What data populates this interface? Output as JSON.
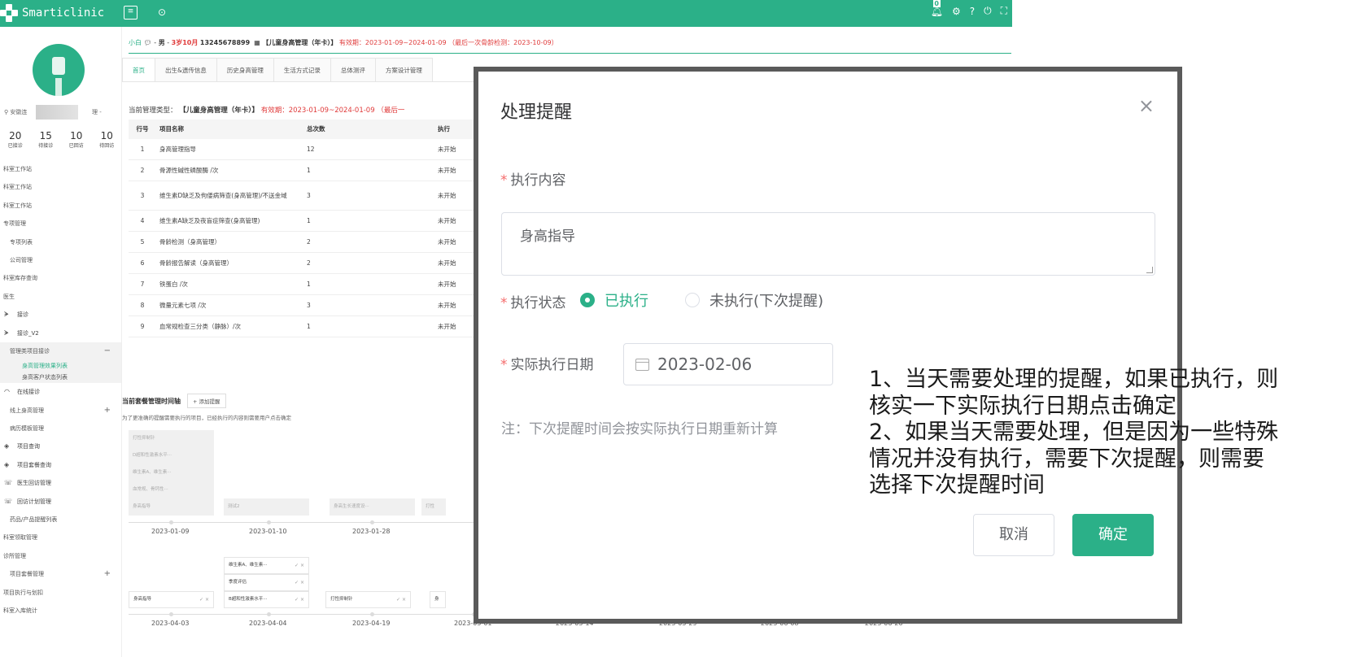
{
  "app": {
    "name": "Smarticlinic"
  },
  "topbar": {
    "notification_count": "0"
  },
  "sidebar": {
    "location": "安徽连",
    "role": "理 -",
    "stats": [
      {
        "num": "20",
        "label": "已接诊"
      },
      {
        "num": "15",
        "label": "待接诊"
      },
      {
        "num": "10",
        "label": "已回访"
      },
      {
        "num": "10",
        "label": "待回访"
      }
    ],
    "nav": [
      {
        "label": "科室工作站",
        "kind": "plain"
      },
      {
        "label": "科室工作站",
        "kind": "plain"
      },
      {
        "label": "科室工作站",
        "kind": "plain"
      },
      {
        "label": "专项管理",
        "kind": "plain"
      },
      {
        "label": "专项列表",
        "kind": "indent"
      },
      {
        "label": "公司管理",
        "kind": "indent"
      },
      {
        "label": "科室库存查询",
        "kind": "plain"
      },
      {
        "label": "医生",
        "kind": "plain"
      },
      {
        "label": "接诊",
        "kind": "icon",
        "icon": "ᗘ"
      },
      {
        "label": "接诊_V2",
        "kind": "icon",
        "icon": "ᗘ"
      },
      {
        "label": "管理类项目接诊",
        "kind": "group",
        "suffix": "−"
      },
      {
        "label": "身高管理效果列表",
        "kind": "active"
      },
      {
        "label": "身高客户状态列表",
        "kind": "sub"
      },
      {
        "label": "在线接诊",
        "kind": "icon",
        "icon": "◠"
      },
      {
        "label": "线上身高管理",
        "kind": "indent",
        "suffix": "+"
      },
      {
        "label": "病历模板管理",
        "kind": "indent"
      },
      {
        "label": "项目查询",
        "kind": "icon",
        "icon": "◈"
      },
      {
        "label": "项目套餐查询",
        "kind": "icon",
        "icon": "◈"
      },
      {
        "label": "医生回访管理",
        "kind": "icon",
        "icon": "☏"
      },
      {
        "label": "回访计划管理",
        "kind": "icon",
        "icon": "☏"
      },
      {
        "label": "药品/产品提醒列表",
        "kind": "indent"
      },
      {
        "label": "科室领取管理",
        "kind": "plain"
      },
      {
        "label": "诊所管理",
        "kind": "plain"
      },
      {
        "label": "项目套餐管理",
        "kind": "indent",
        "suffix": "+"
      },
      {
        "label": "项目执行与划扣",
        "kind": "plain"
      },
      {
        "label": "科室入库统计",
        "kind": "plain"
      }
    ]
  },
  "patient": {
    "name": "小白",
    "gender": "男",
    "age": "3岁10月",
    "phone": "13245678899",
    "package": "【儿童身高管理（年卡）】",
    "validity": "有效期：2023-01-09~2024-01-09",
    "last_check": "（最后一次骨龄检测：2023-10-09）"
  },
  "tabs": [
    "首页",
    "出生&遗传信息",
    "历史身高管理",
    "生活方式记录",
    "总体测评",
    "方案设计管理"
  ],
  "management": {
    "type_label": "当前管理类型：",
    "type_value": "【儿童身高管理（年卡）】",
    "validity": "有效期：2023-01-09~2024-01-09",
    "extra": "（最后一"
  },
  "table": {
    "headers": [
      "行号",
      "项目名称",
      "总次数",
      "执行"
    ],
    "rows": [
      {
        "no": "1",
        "name": "身高管理指导",
        "total": "12",
        "status": "未开始"
      },
      {
        "no": "2",
        "name": "骨源性碱性磷酸酶 /次",
        "total": "1",
        "status": "未开始"
      },
      {
        "no": "3",
        "name": "维生素D缺乏及佝偻病筛查(身高管理)/不送金域",
        "total": "3",
        "status": "未开始"
      },
      {
        "no": "4",
        "name": "维生素A缺乏及夜盲症筛查(身高管理)",
        "total": "1",
        "status": "未开始"
      },
      {
        "no": "5",
        "name": "骨龄检测（身高管理）",
        "total": "2",
        "status": "未开始"
      },
      {
        "no": "6",
        "name": "骨龄报告解读（身高管理）",
        "total": "2",
        "status": "未开始"
      },
      {
        "no": "7",
        "name": "铁蛋白 /次",
        "total": "1",
        "status": "未开始"
      },
      {
        "no": "8",
        "name": "微量元素七项 /次",
        "total": "3",
        "status": "未开始"
      },
      {
        "no": "9",
        "name": "血常规检查三分类（静脉）/次",
        "total": "1",
        "status": "未开始"
      }
    ]
  },
  "timeline": {
    "title": "当前套餐管理时间轴",
    "add_label": "+ 添加提醒",
    "note": "为了更准确的提醒需要执行的项目，已经执行的内容则需要用户点击确定",
    "row1_cards": [
      "打性抑制针",
      "D超和性激素水平···",
      "维生素A、维生素···",
      "血常规、骨钙性···",
      "身高指导"
    ],
    "row1_others": [
      "测试2",
      "身高生长速度设···",
      "打性"
    ],
    "row1_dates": [
      "2023-01-09",
      "2023-01-10",
      "2023-01-28"
    ],
    "row2_cards": [
      {
        "label": "维生素A、维生素···",
        "chk": "✓ ×"
      },
      {
        "label": "季度评估",
        "chk": "✓ ×"
      },
      {
        "label": "B超和性激素水平···",
        "chk": "✓ ×"
      },
      {
        "label": "身高指导",
        "chk": "✓ ×"
      },
      {
        "label": "打性抑制针",
        "chk": "✓ ×"
      },
      {
        "label": "身",
        "chk": ""
      }
    ],
    "row2_dates": [
      "2023-04-03",
      "2023-04-04",
      "2023-04-19",
      "2023-05-01",
      "2023-05-14",
      "2023-05-29",
      "2023-06-08",
      "2023-06-26"
    ]
  },
  "dialog": {
    "title": "处理提醒",
    "close": "×",
    "content_label": "执行内容",
    "content_value": "身高指导",
    "status_label": "执行状态",
    "status_options": [
      "已执行",
      "未执行(下次提醒)"
    ],
    "status_selected": "已执行",
    "date_label": "实际执行日期",
    "date_value": "2023-02-06",
    "note": "注：下次提醒时间会按实际执行日期重新计算",
    "cancel": "取消",
    "confirm": "确定"
  },
  "annotation": {
    "lines": [
      "1、当天需要处理的提醒，如果已执行，则",
      "核实一下实际执行日期点击确定",
      "2、如果当天需要处理，但是因为一些特殊",
      "情况并没有执行，需要下次提醒，则需要",
      "选择下次提醒时间"
    ]
  },
  "behind_text": {
    "top_right_fragment": "未开始",
    "close_hint": "()"
  }
}
